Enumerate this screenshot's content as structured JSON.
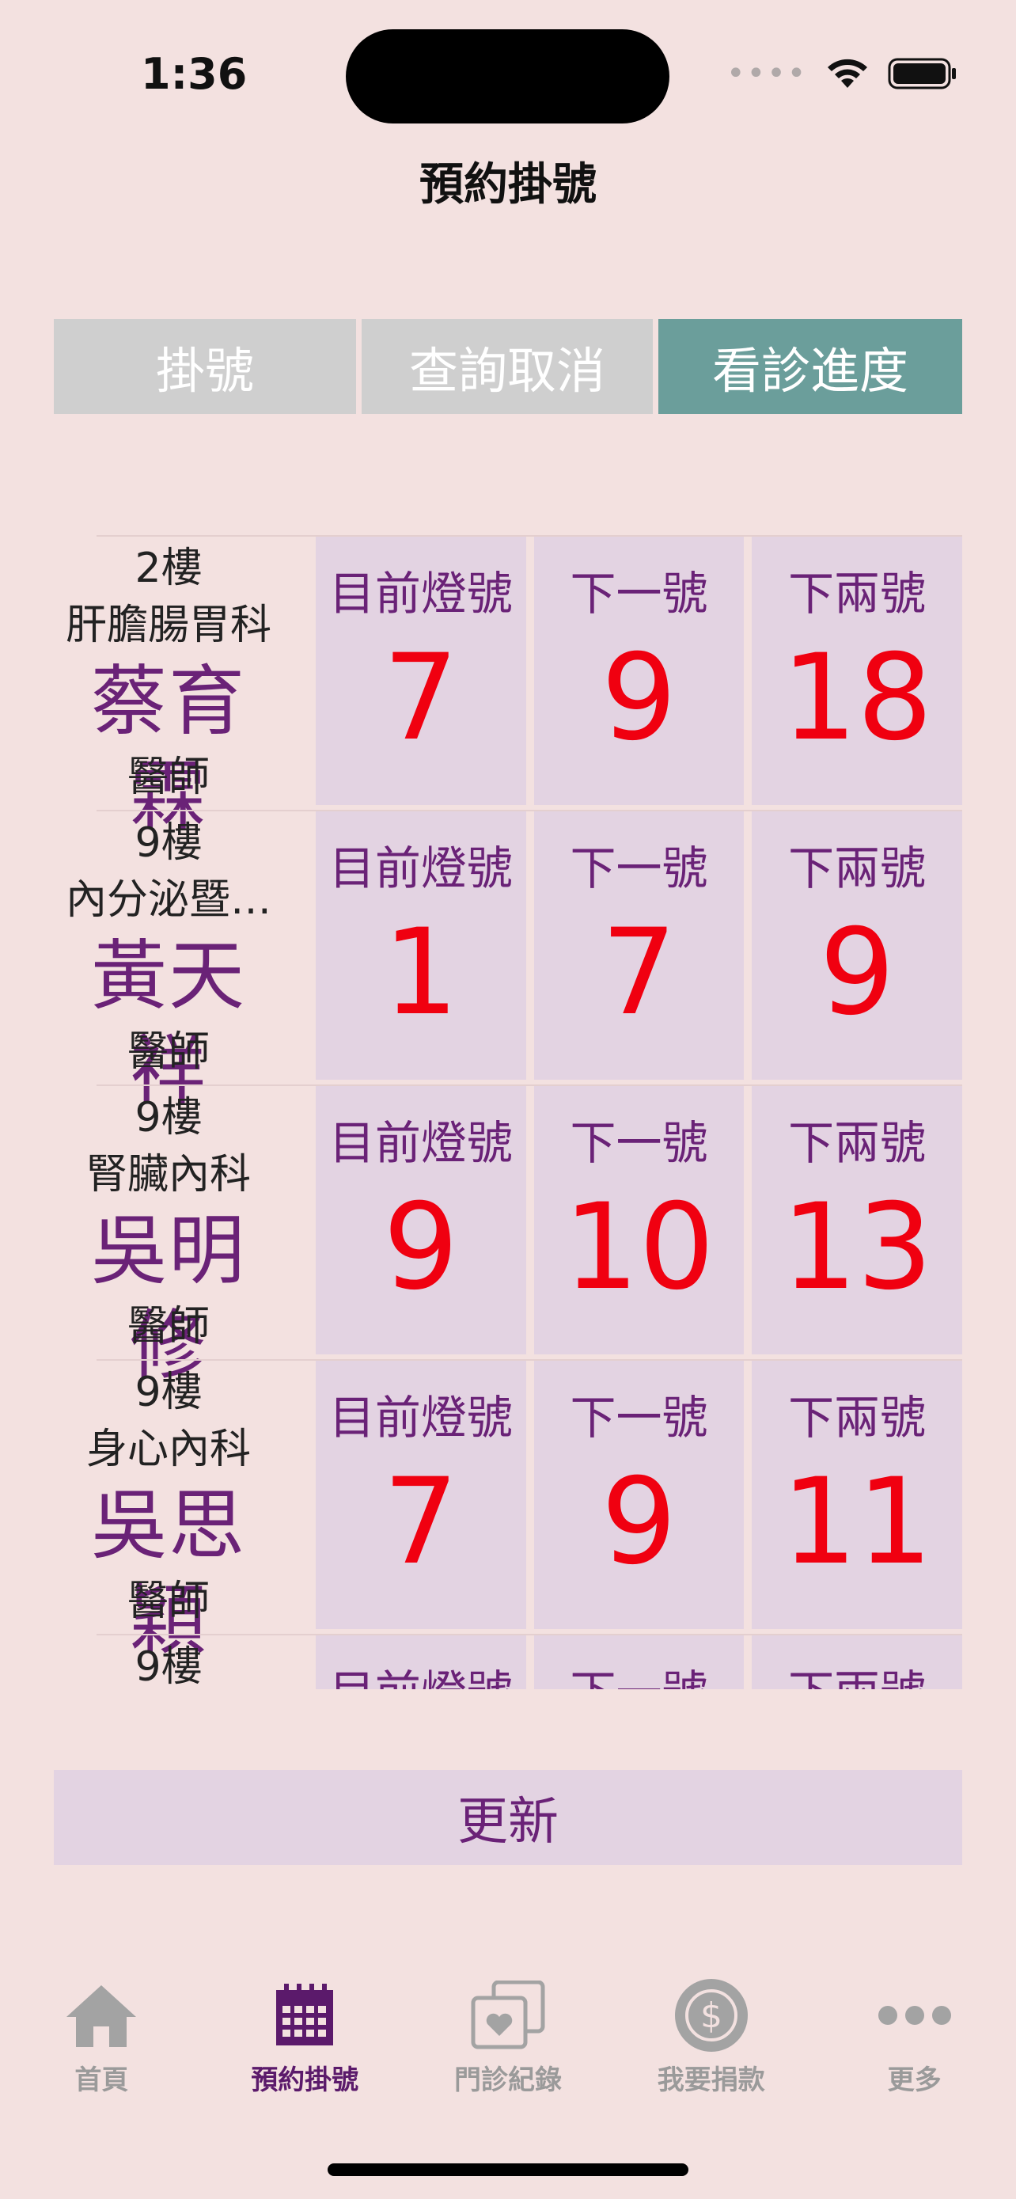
{
  "status_bar": {
    "time": "1:36",
    "signal_dots": "••••"
  },
  "header": {
    "title": "預約掛號"
  },
  "tabs": [
    {
      "label": "掛號",
      "active": false
    },
    {
      "label": "查詢取消",
      "active": false
    },
    {
      "label": "看診進度",
      "active": true
    }
  ],
  "column_labels": {
    "current": "目前燈號",
    "next": "下一號",
    "next2": "下兩號"
  },
  "doctors": [
    {
      "floor": "2樓",
      "dept": "肝膽腸胃科",
      "name": "蔡育霖",
      "role": "醫師",
      "current": "7",
      "next": "9",
      "next2": "18"
    },
    {
      "floor": "9樓",
      "dept": "內分泌暨…",
      "name": "黃天祥",
      "role": "醫師",
      "current": "1",
      "next": "7",
      "next2": "9"
    },
    {
      "floor": "9樓",
      "dept": "腎臟內科",
      "name": "吳明修",
      "role": "醫師",
      "current": "9",
      "next": "10",
      "next2": "13"
    },
    {
      "floor": "9樓",
      "dept": "身心內科",
      "name": "吳思穎",
      "role": "醫師",
      "current": "7",
      "next": "9",
      "next2": "11"
    },
    {
      "floor": "9樓",
      "dept": "",
      "name": "",
      "role": "",
      "current": "",
      "next": "",
      "next2": ""
    }
  ],
  "refresh_label": "更新",
  "tabbar": [
    {
      "label": "首頁",
      "icon": "home-icon",
      "active": false
    },
    {
      "label": "預約掛號",
      "icon": "calendar-icon",
      "active": true
    },
    {
      "label": "門診紀錄",
      "icon": "records-icon",
      "active": false
    },
    {
      "label": "我要捐款",
      "icon": "donate-icon",
      "active": false
    },
    {
      "label": "更多",
      "icon": "more-icon",
      "active": false
    }
  ],
  "colors": {
    "background": "#f3e1e0",
    "accent": "#6a2277",
    "tab_active": "#6b9e9b",
    "number": "#f00010",
    "cell_bg": "#e3d3e2"
  }
}
